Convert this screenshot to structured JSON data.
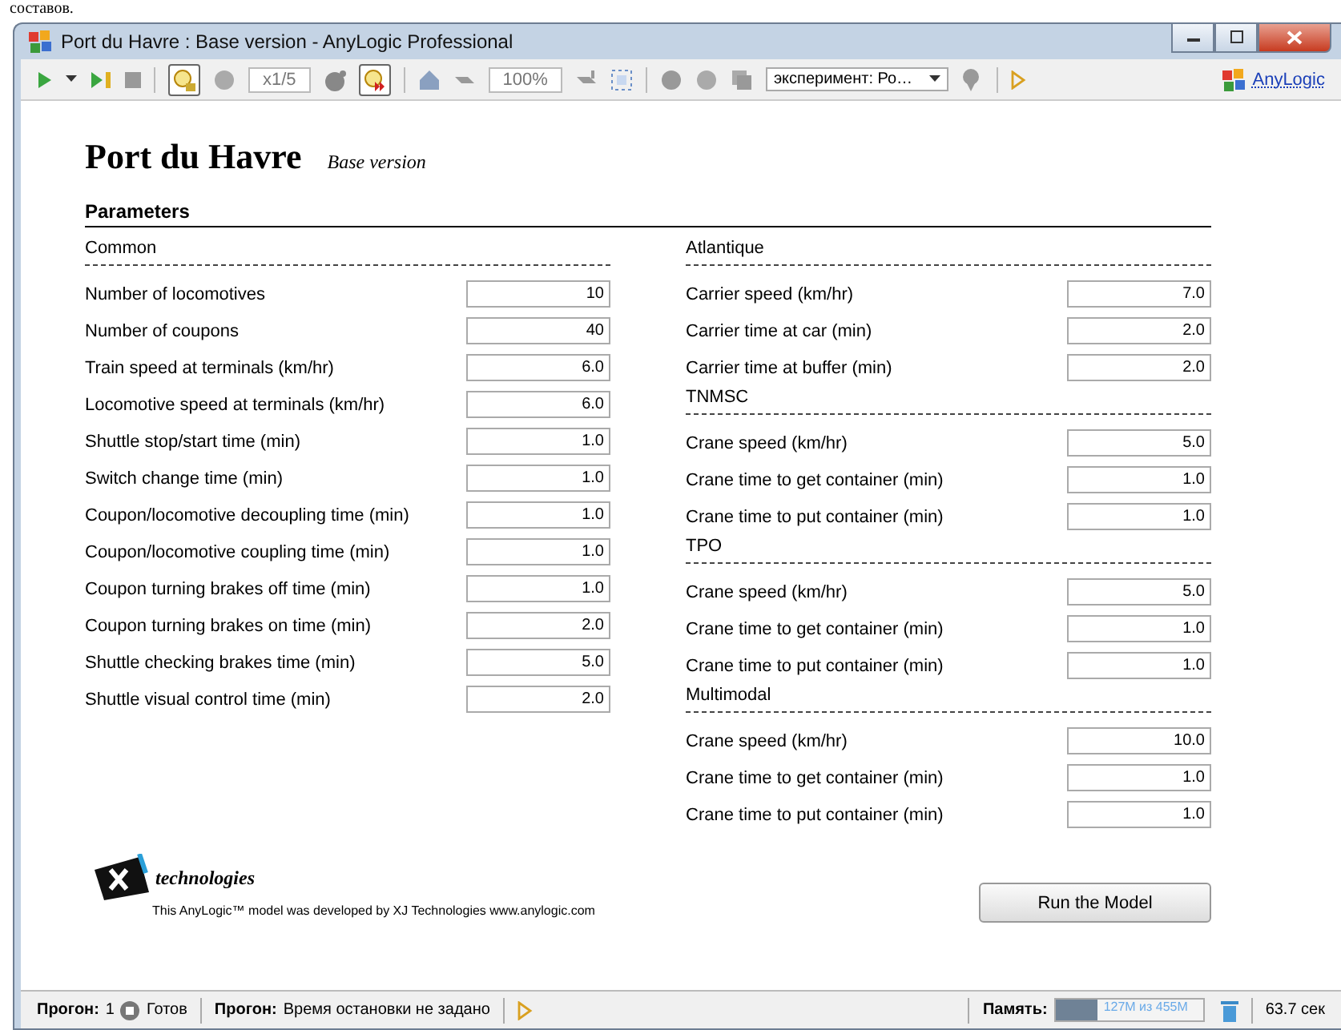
{
  "document_text": "составов.",
  "window": {
    "title": "Port du Havre : Base version - AnyLogic Professional"
  },
  "toolbar": {
    "realtime": {
      "selected": true
    },
    "speed": "x1/5",
    "fast": {
      "selected": true
    },
    "zoom": "100%",
    "experiment": "эксперимент: Ро…",
    "brand": "AnyLogic"
  },
  "heading": {
    "title": "Port du Havre",
    "subtitle": "Base version",
    "section": "Parameters"
  },
  "columns": [
    [
      {
        "title": "Common",
        "params": [
          {
            "label": "Number of locomotives",
            "value": "10"
          },
          {
            "label": "Number of coupons",
            "value": "40"
          },
          {
            "label": "Train speed at terminals (km/hr)",
            "value": "6.0"
          },
          {
            "label": "Locomotive speed at terminals (km/hr)",
            "value": "6.0"
          },
          {
            "label": "Shuttle stop/start time (min)",
            "value": "1.0"
          },
          {
            "label": "Switch change time (min)",
            "value": "1.0"
          },
          {
            "label": "Coupon/locomotive decoupling time (min)",
            "value": "1.0"
          },
          {
            "label": "Coupon/locomotive coupling time (min)",
            "value": "1.0"
          },
          {
            "label": "Coupon turning brakes off time (min)",
            "value": "1.0"
          },
          {
            "label": "Coupon turning brakes on time (min)",
            "value": "2.0"
          },
          {
            "label": "Shuttle checking brakes time (min)",
            "value": "5.0"
          },
          {
            "label": "Shuttle visual control time (min)",
            "value": "2.0"
          }
        ]
      }
    ],
    [
      {
        "title": "Atlantique",
        "params": [
          {
            "label": "Carrier speed (km/hr)",
            "value": "7.0"
          },
          {
            "label": "Carrier time at car (min)",
            "value": "2.0"
          },
          {
            "label": "Carrier time at buffer (min)",
            "value": "2.0"
          }
        ]
      },
      {
        "title": "TNMSC",
        "params": [
          {
            "label": "Crane speed (km/hr)",
            "value": "5.0"
          },
          {
            "label": "Crane time to get container (min)",
            "value": "1.0"
          },
          {
            "label": "Crane time to put container (min)",
            "value": "1.0"
          }
        ]
      },
      {
        "title": "TPO",
        "params": [
          {
            "label": "Crane speed (km/hr)",
            "value": "5.0"
          },
          {
            "label": "Crane time to get container (min)",
            "value": "1.0"
          },
          {
            "label": "Crane time to put container (min)",
            "value": "1.0"
          }
        ]
      },
      {
        "title": "Multimodal",
        "params": [
          {
            "label": "Crane speed (km/hr)",
            "value": "10.0"
          },
          {
            "label": "Crane time to get container (min)",
            "value": "1.0"
          },
          {
            "label": "Crane time to put container (min)",
            "value": "1.0"
          }
        ]
      }
    ]
  ],
  "footer": {
    "logo_text": "technologies",
    "credit": "This AnyLogic™ model was developed by XJ Technologies www.anylogic.com",
    "button": "Run the Model"
  },
  "status_bar": {
    "run_label": "Прогон:",
    "run_number": "1",
    "run_state": "Готов",
    "stop_label": "Прогон:",
    "stop_text": "Время остановки не задано",
    "memory_label": "Память:",
    "memory_text": "127M из 455M",
    "memory": {
      "level": 0.28
    },
    "time": "63.7 сек"
  }
}
